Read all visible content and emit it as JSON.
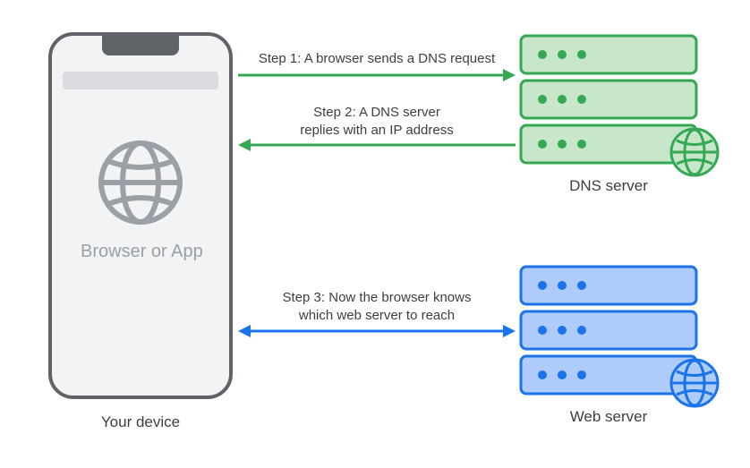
{
  "device": {
    "label": "Browser or App",
    "caption": "Your device"
  },
  "dns_server": {
    "caption": "DNS server"
  },
  "web_server": {
    "caption": "Web server"
  },
  "steps": {
    "s1": "Step 1: A browser sends a DNS request",
    "s2_line1": "Step 2: A DNS server",
    "s2_line2": "replies with an IP address",
    "s3_line1": "Step 3: Now the browser knows",
    "s3_line2": "which web server to reach"
  },
  "colors": {
    "green_stroke": "#34a853",
    "green_fill": "#c8e6c9",
    "blue_stroke": "#1a73e8",
    "blue_fill": "#aecbfa",
    "phone_stroke": "#5f6368",
    "phone_fill": "#f1f3f4",
    "grey_icon": "#9aa0a6",
    "grey_bar": "#dadce0"
  }
}
